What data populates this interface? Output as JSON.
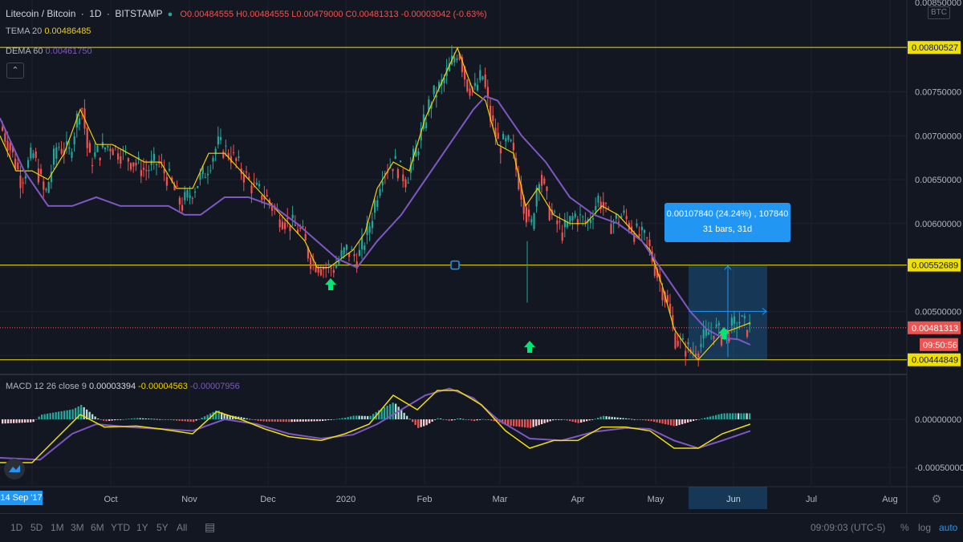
{
  "header": {
    "symbol": "Litecoin / Bitcoin",
    "interval": "1D",
    "exchange": "BITSTAMP",
    "ohlc": {
      "o": "O0.00484555",
      "h": "H0.00484555",
      "l": "L0.00479000",
      "c": "C0.00481313",
      "chg": "-0.00003042 (-0.63%)"
    }
  },
  "indicators": {
    "tema": {
      "label": "TEMA 20",
      "value": "0.00486485",
      "color": "#f0d000"
    },
    "dema": {
      "label": "DEMA 60",
      "value": "0.00461750",
      "color": "#7e57c2"
    },
    "macd": {
      "label": "MACD 12 26 close 9",
      "v1": "0.00003394",
      "v2": "-0.00004563",
      "v3": "-0.00007956"
    }
  },
  "price_axis": {
    "currency": "BTC",
    "ticks": [
      "0.00750000",
      "0.00700000",
      "0.00650000",
      "0.00600000",
      "0.00500000"
    ],
    "top_partial": "0.00850000",
    "hlines": [
      {
        "label": "0.00800527",
        "value": 0.00800527
      },
      {
        "label": "0.00552689",
        "value": 0.00552689
      },
      {
        "label": "0.00444849",
        "value": 0.00444849
      }
    ],
    "last_price": {
      "label": "0.00481313",
      "value": 0.00481313
    },
    "countdown": "09:50:56"
  },
  "macd_axis": {
    "ticks": [
      "0.00000000",
      "-0.00050000"
    ]
  },
  "time_axis": {
    "start_badge": "14 Sep '17",
    "labels": [
      "Oct",
      "Nov",
      "Dec",
      "2020",
      "Feb",
      "Mar",
      "Apr",
      "May",
      "Jun",
      "Jul",
      "Aug"
    ],
    "highlight": "Jun"
  },
  "measure": {
    "line1": "0.00107840 (24.24%) , 107840",
    "line2": "31 bars, 31d"
  },
  "bottom": {
    "ranges": [
      "1D",
      "5D",
      "1M",
      "3M",
      "6M",
      "YTD",
      "1Y",
      "5Y",
      "All"
    ],
    "clock": "09:09:03 (UTC-5)",
    "percent": "%",
    "log": "log",
    "auto": "auto"
  },
  "chart_data": {
    "type": "candlestick",
    "title": "Litecoin / Bitcoin 1D BITSTAMP",
    "ylim": [
      0.0043,
      0.0086
    ],
    "close_series": [
      [
        0,
        0.0071
      ],
      [
        10,
        0.0069
      ],
      [
        25,
        0.0065
      ],
      [
        40,
        0.0068
      ],
      [
        55,
        0.0063
      ],
      [
        70,
        0.0069
      ],
      [
        85,
        0.0068
      ],
      [
        100,
        0.0074
      ],
      [
        110,
        0.0067
      ],
      [
        120,
        0.0068
      ],
      [
        135,
        0.0069
      ],
      [
        150,
        0.0068
      ],
      [
        165,
        0.0067
      ],
      [
        180,
        0.0066
      ],
      [
        195,
        0.0067
      ],
      [
        210,
        0.0065
      ],
      [
        225,
        0.0062
      ],
      [
        240,
        0.0064
      ],
      [
        255,
        0.0066
      ],
      [
        270,
        0.0069
      ],
      [
        285,
        0.0068
      ],
      [
        300,
        0.0066
      ],
      [
        315,
        0.0064
      ],
      [
        330,
        0.0063
      ],
      [
        345,
        0.0061
      ],
      [
        360,
        0.006
      ],
      [
        375,
        0.0059
      ],
      [
        385,
        0.0056
      ],
      [
        400,
        0.0055
      ],
      [
        415,
        0.0055
      ],
      [
        430,
        0.0057
      ],
      [
        445,
        0.0056
      ],
      [
        460,
        0.006
      ],
      [
        475,
        0.0066
      ],
      [
        490,
        0.0067
      ],
      [
        505,
        0.0065
      ],
      [
        520,
        0.0069
      ],
      [
        535,
        0.0074
      ],
      [
        550,
        0.0076
      ],
      [
        560,
        0.0078
      ],
      [
        570,
        0.008
      ],
      [
        580,
        0.0076
      ],
      [
        590,
        0.0075
      ],
      [
        600,
        0.0077
      ],
      [
        610,
        0.0072
      ],
      [
        620,
        0.0069
      ],
      [
        635,
        0.0069
      ],
      [
        650,
        0.0063
      ],
      [
        660,
        0.0059
      ],
      [
        670,
        0.0066
      ],
      [
        685,
        0.0061
      ],
      [
        700,
        0.0059
      ],
      [
        715,
        0.0061
      ],
      [
        730,
        0.006
      ],
      [
        745,
        0.0063
      ],
      [
        760,
        0.006
      ],
      [
        775,
        0.0061
      ],
      [
        790,
        0.0059
      ],
      [
        805,
        0.0058
      ],
      [
        815,
        0.0055
      ],
      [
        830,
        0.0051
      ],
      [
        840,
        0.0047
      ],
      [
        850,
        0.0046
      ],
      [
        860,
        0.00455
      ],
      [
        870,
        0.0046
      ],
      [
        880,
        0.00475
      ],
      [
        890,
        0.0048
      ],
      [
        900,
        0.0047
      ],
      [
        910,
        0.0048
      ],
      [
        920,
        0.0049
      ],
      [
        930,
        0.00481
      ]
    ],
    "tema_series": [
      [
        0,
        0.007
      ],
      [
        20,
        0.0066
      ],
      [
        40,
        0.0066
      ],
      [
        60,
        0.0065
      ],
      [
        80,
        0.0068
      ],
      [
        100,
        0.0073
      ],
      [
        120,
        0.0069
      ],
      [
        140,
        0.0069
      ],
      [
        160,
        0.0068
      ],
      [
        180,
        0.0067
      ],
      [
        200,
        0.0067
      ],
      [
        220,
        0.0064
      ],
      [
        240,
        0.0064
      ],
      [
        260,
        0.0068
      ],
      [
        280,
        0.0068
      ],
      [
        300,
        0.0066
      ],
      [
        320,
        0.0064
      ],
      [
        340,
        0.0062
      ],
      [
        360,
        0.006
      ],
      [
        380,
        0.0058
      ],
      [
        395,
        0.0055
      ],
      [
        410,
        0.0055
      ],
      [
        425,
        0.0056
      ],
      [
        440,
        0.0057
      ],
      [
        455,
        0.0059
      ],
      [
        470,
        0.0064
      ],
      [
        490,
        0.0067
      ],
      [
        510,
        0.0066
      ],
      [
        530,
        0.0072
      ],
      [
        550,
        0.0076
      ],
      [
        570,
        0.008
      ],
      [
        590,
        0.0075
      ],
      [
        605,
        0.0074
      ],
      [
        620,
        0.0069
      ],
      [
        640,
        0.0068
      ],
      [
        655,
        0.0062
      ],
      [
        670,
        0.0064
      ],
      [
        690,
        0.0061
      ],
      [
        710,
        0.006
      ],
      [
        730,
        0.006
      ],
      [
        750,
        0.0062
      ],
      [
        770,
        0.0061
      ],
      [
        790,
        0.0059
      ],
      [
        810,
        0.0057
      ],
      [
        825,
        0.0053
      ],
      [
        840,
        0.0048
      ],
      [
        855,
        0.0046
      ],
      [
        870,
        0.00445
      ],
      [
        885,
        0.0046
      ],
      [
        900,
        0.00475
      ],
      [
        915,
        0.0048
      ],
      [
        935,
        0.00487
      ]
    ],
    "dema_series": [
      [
        0,
        0.0072
      ],
      [
        30,
        0.0066
      ],
      [
        60,
        0.0062
      ],
      [
        90,
        0.0062
      ],
      [
        120,
        0.0063
      ],
      [
        150,
        0.0062
      ],
      [
        180,
        0.0062
      ],
      [
        210,
        0.0062
      ],
      [
        230,
        0.0061
      ],
      [
        250,
        0.0061
      ],
      [
        280,
        0.0063
      ],
      [
        310,
        0.0063
      ],
      [
        340,
        0.0062
      ],
      [
        370,
        0.006
      ],
      [
        395,
        0.0058
      ],
      [
        420,
        0.0056
      ],
      [
        445,
        0.0055
      ],
      [
        470,
        0.0058
      ],
      [
        500,
        0.0061
      ],
      [
        530,
        0.0065
      ],
      [
        560,
        0.0069
      ],
      [
        590,
        0.0073
      ],
      [
        605,
        0.00745
      ],
      [
        620,
        0.0074
      ],
      [
        650,
        0.007
      ],
      [
        680,
        0.0067
      ],
      [
        710,
        0.0063
      ],
      [
        740,
        0.0061
      ],
      [
        770,
        0.006
      ],
      [
        800,
        0.0058
      ],
      [
        830,
        0.0054
      ],
      [
        860,
        0.005
      ],
      [
        880,
        0.0048
      ],
      [
        900,
        0.0047
      ],
      [
        920,
        0.00468
      ],
      [
        935,
        0.00462
      ]
    ],
    "macd_series": [
      [
        0,
        -0.00045
      ],
      [
        40,
        -0.00045
      ],
      [
        70,
        -0.0002
      ],
      [
        100,
        5e-05
      ],
      [
        130,
        -8e-05
      ],
      [
        170,
        -7e-05
      ],
      [
        200,
        -0.0001
      ],
      [
        240,
        -0.00015
      ],
      [
        270,
        8e-05
      ],
      [
        300,
        0.0
      ],
      [
        330,
        -0.0001
      ],
      [
        360,
        -0.00018
      ],
      [
        400,
        -0.00022
      ],
      [
        430,
        -0.00015
      ],
      [
        460,
        -5e-05
      ],
      [
        490,
        0.00025
      ],
      [
        520,
        0.0001
      ],
      [
        545,
        0.0003
      ],
      [
        570,
        0.0003
      ],
      [
        600,
        0.00015
      ],
      [
        630,
        -0.00012
      ],
      [
        660,
        -0.0003
      ],
      [
        690,
        -0.00022
      ],
      [
        720,
        -0.00022
      ],
      [
        750,
        -8e-05
      ],
      [
        780,
        -8e-05
      ],
      [
        810,
        -0.00012
      ],
      [
        840,
        -0.0003
      ],
      [
        870,
        -0.0003
      ],
      [
        900,
        -0.00015
      ],
      [
        935,
        -5e-05
      ]
    ],
    "signal_series": [
      [
        0,
        -0.0004
      ],
      [
        50,
        -0.00042
      ],
      [
        90,
        -0.00015
      ],
      [
        120,
        -5e-05
      ],
      [
        160,
        -8e-05
      ],
      [
        200,
        -0.0001
      ],
      [
        240,
        -0.00012
      ],
      [
        280,
        0.0
      ],
      [
        320,
        -5e-05
      ],
      [
        360,
        -0.00015
      ],
      [
        400,
        -0.0002
      ],
      [
        440,
        -0.00016
      ],
      [
        470,
        -5e-05
      ],
      [
        500,
        0.0001
      ],
      [
        530,
        0.00025
      ],
      [
        560,
        0.00032
      ],
      [
        590,
        0.00022
      ],
      [
        620,
        0.0
      ],
      [
        660,
        -0.0002
      ],
      [
        700,
        -0.00022
      ],
      [
        740,
        -0.00013
      ],
      [
        780,
        -9e-05
      ],
      [
        810,
        -0.0001
      ],
      [
        840,
        -0.00022
      ],
      [
        870,
        -0.0003
      ],
      [
        900,
        -0.00022
      ],
      [
        935,
        -0.00012
      ]
    ]
  }
}
